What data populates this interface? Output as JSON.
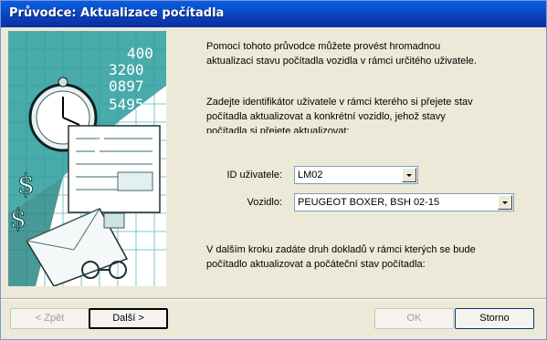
{
  "window": {
    "title": "Průvodce: Aktualizace počítadla"
  },
  "intro": {
    "line1": "Pomocí tohoto průvodce můžete provést hromadnou",
    "line2": "aktualizaci stavu počítadla vozidla v rámci určitého uživatele."
  },
  "instructions": {
    "line1": "Zadejte identifikátor uživatele v rámci kterého si přejete stav",
    "line2": "počítadla aktualizovat a konkrétní vozidlo, jehož stavy",
    "line3": "počítadla si přejete aktualizovat:"
  },
  "form": {
    "user_label": "ID uživatele:",
    "user_value": "LM02",
    "vehicle_label": "Vozidlo:",
    "vehicle_value": "PEUGEOT BOXER, BSH 02-15"
  },
  "footer_note": {
    "line1": "V dalším kroku zadáte druh dokladů v rámci kterých se bude",
    "line2": "počítadlo aktualizovat a počáteční stav počítadla:"
  },
  "illustration": {
    "numbers": [
      "400",
      "3200",
      "0897",
      "5495"
    ]
  },
  "buttons": {
    "back": "< Zpět",
    "next": "Další >",
    "ok": "OK",
    "cancel": "Storno"
  }
}
